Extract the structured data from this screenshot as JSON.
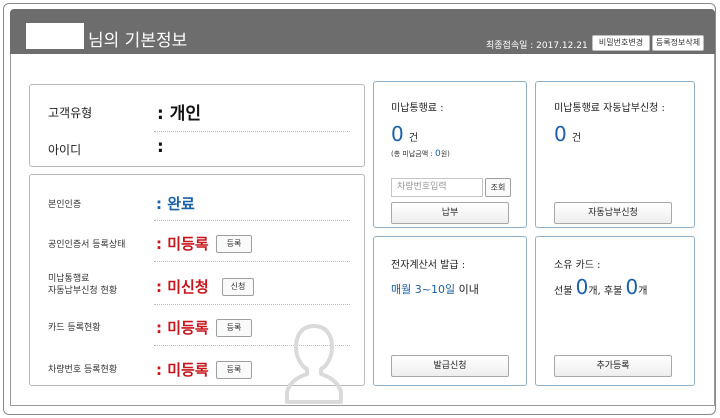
{
  "header": {
    "title_suffix": "님의 기본정보",
    "last_login": "최종접속일 : 2017.12.21",
    "change_password": "비밀번호변경",
    "edit_registration": "등록정보삭제"
  },
  "profile": {
    "member_type_label": "고객유형",
    "member_type_value": ": 개인",
    "id_label": "아이디",
    "id_value": ":"
  },
  "status_rows": [
    {
      "label": "본인인증",
      "value": ": 완료",
      "color": "#1a5faa"
    },
    {
      "label": "공인인증서 등록상태",
      "value": ": 미등록",
      "button": "등록",
      "color": "#c8151b"
    },
    {
      "label": "미납통행료\n자동납부신청 현황",
      "value": ": 미신청",
      "button": "신청",
      "color": "#c8151b"
    },
    {
      "label": "카드 등록현황",
      "value": ": 미등록",
      "button": "등록",
      "color": "#c8151b"
    },
    {
      "label": "차량번호 등록현황",
      "value": ": 미등록",
      "button": "등록",
      "color": "#c8151b"
    }
  ],
  "unpaid": {
    "title": "미납통행료 :",
    "count": "0",
    "unit": "건",
    "note_prefix": "(총 미납금액 : ",
    "note_amount": "0",
    "note_suffix": "원)",
    "input_placeholder": "차량번호입력",
    "search_button": "조회",
    "pay_button": "납부"
  },
  "autopay": {
    "title": "미납통행료 자동납부신청 :",
    "count": "0",
    "unit": "건",
    "apply_button": "자동납부신청"
  },
  "etax": {
    "title": "전자계산서 발급 :",
    "schedule_blue": "매월 3~10일",
    "schedule_suffix": " 이내",
    "issue_button": "발급신청"
  },
  "cards": {
    "title": "소유 카드 :",
    "prepaid_label": "선불 ",
    "prepaid_count": "0",
    "prepaid_unit": "개,  ",
    "postpaid_label": "후불 ",
    "postpaid_count": "0",
    "postpaid_unit": "개",
    "add_button": "추가등록"
  },
  "colors": {
    "header_bg": "#6d6d6d",
    "accent_blue": "#1a5faa",
    "alert_red": "#c8151b",
    "card_border": "#8fb0c9"
  }
}
